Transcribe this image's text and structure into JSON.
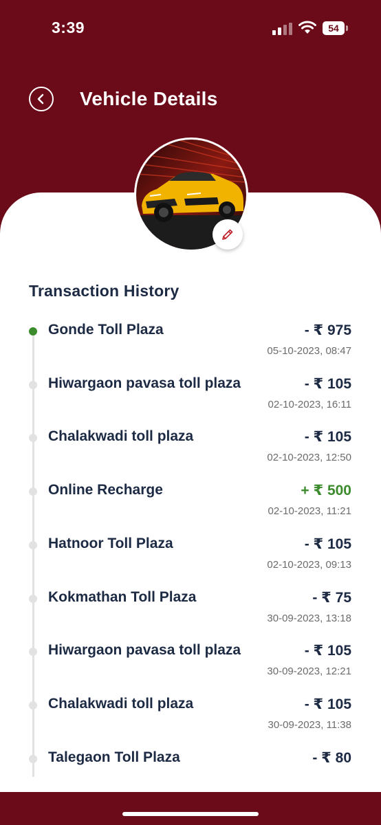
{
  "status_bar": {
    "time": "3:39",
    "battery_level": "54",
    "icons": [
      "cellular-signal-icon",
      "wifi-icon",
      "battery-icon"
    ]
  },
  "header": {
    "title": "Vehicle Details",
    "back_icon": "chevron-left-icon"
  },
  "vehicle": {
    "edit_icon": "pencil-icon"
  },
  "transactions": {
    "section_title": "Transaction History",
    "items": [
      {
        "name": "Gonde Toll Plaza",
        "amount": "- ₹ 975",
        "date": "05-10-2023, 08:47",
        "type": "debit"
      },
      {
        "name": "Hiwargaon pavasa toll plaza",
        "amount": "- ₹ 105",
        "date": "02-10-2023, 16:11",
        "type": "debit"
      },
      {
        "name": "Chalakwadi  toll plaza",
        "amount": "- ₹ 105",
        "date": "02-10-2023, 12:50",
        "type": "debit"
      },
      {
        "name": "Online Recharge",
        "amount": "+ ₹ 500",
        "date": "02-10-2023, 11:21",
        "type": "credit"
      },
      {
        "name": "Hatnoor Toll Plaza",
        "amount": "- ₹ 105",
        "date": "02-10-2023, 09:13",
        "type": "debit"
      },
      {
        "name": "Kokmathan Toll Plaza",
        "amount": "- ₹ 75",
        "date": "30-09-2023, 13:18",
        "type": "debit"
      },
      {
        "name": "Hiwargaon pavasa toll plaza",
        "amount": "- ₹ 105",
        "date": "30-09-2023, 12:21",
        "type": "debit"
      },
      {
        "name": "Chalakwadi  toll plaza",
        "amount": "- ₹ 105",
        "date": "30-09-2023, 11:38",
        "type": "debit"
      },
      {
        "name": "Talegaon Toll Plaza",
        "amount": "- ₹ 80",
        "date": "",
        "type": "debit"
      }
    ]
  },
  "colors": {
    "brand": "#6b0a18",
    "text_primary": "#1d2a44",
    "credit": "#3c8c2e",
    "timeline": "#e2e2e2",
    "date_text": "#6b6b6b"
  }
}
